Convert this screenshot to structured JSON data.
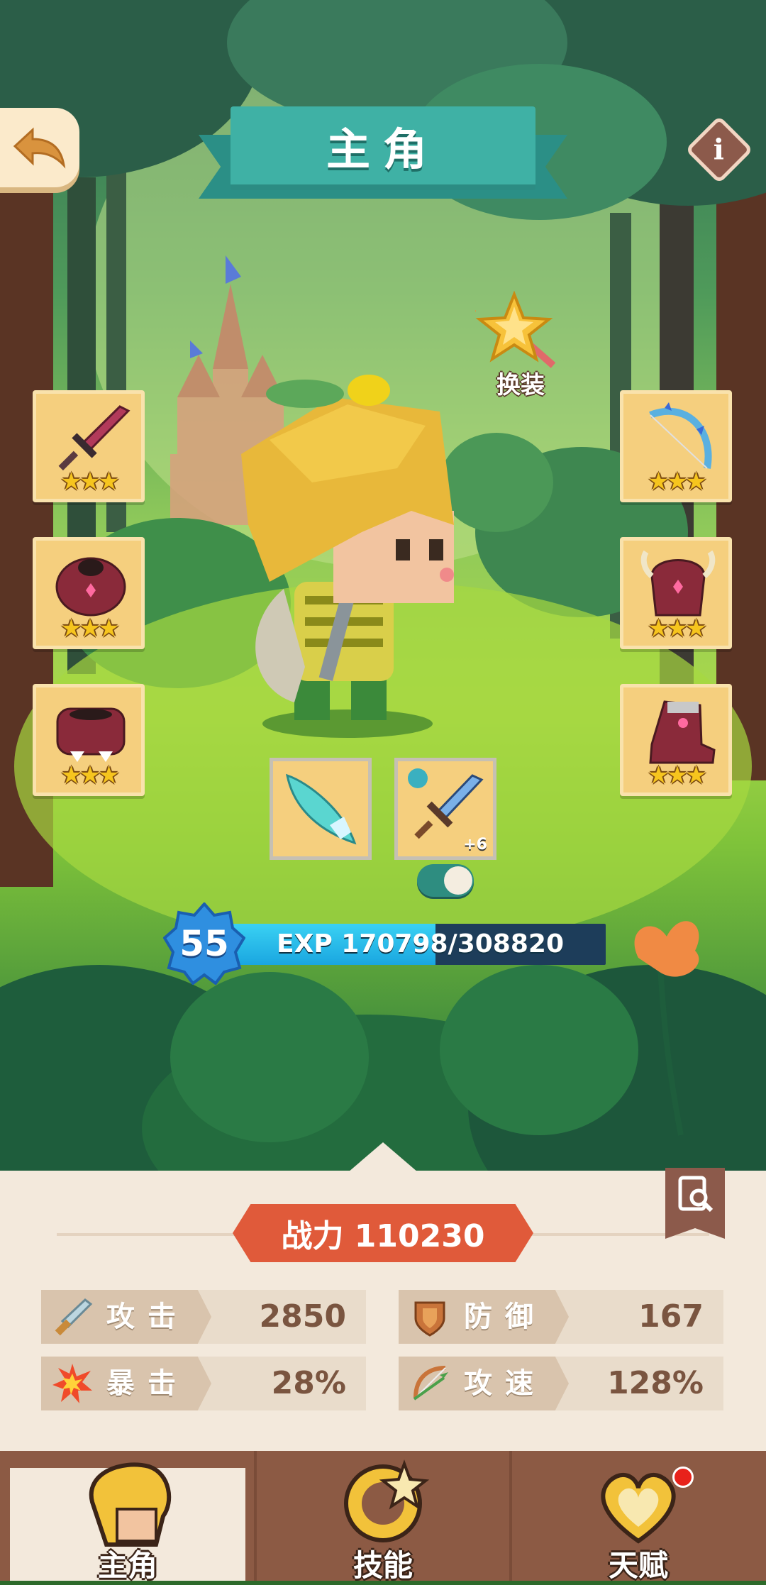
{
  "header": {
    "title": "主角"
  },
  "swap_costume": {
    "label": "换装"
  },
  "equipment": {
    "left": [
      {
        "name": "weapon",
        "stars": "★★★"
      },
      {
        "name": "armor",
        "stars": "★★★"
      },
      {
        "name": "pants",
        "stars": "★★★"
      }
    ],
    "right": [
      {
        "name": "bow",
        "stars": "★★★"
      },
      {
        "name": "helmet",
        "stars": "★★★"
      },
      {
        "name": "boots",
        "stars": "★★★"
      }
    ]
  },
  "weapons": {
    "enhance_level": "+6"
  },
  "toggle": {
    "on": true
  },
  "level": {
    "value": "55",
    "exp_text": "EXP 170798/308820",
    "exp_current": 170798,
    "exp_max": 308820
  },
  "power": {
    "text": "战力 110230"
  },
  "stats": {
    "attack": {
      "label": "攻击",
      "value": "2850"
    },
    "defense": {
      "label": "防御",
      "value": "167"
    },
    "crit": {
      "label": "暴击",
      "value": "28%"
    },
    "attack_speed": {
      "label": "攻速",
      "value": "128%"
    }
  },
  "tabs": [
    {
      "label": "主角",
      "active": true
    },
    {
      "label": "技能",
      "active": false
    },
    {
      "label": "天赋",
      "active": false,
      "badge": true
    }
  ],
  "colors": {
    "title_ribbon": "#3fb1a5",
    "power_banner": "#e05a3a",
    "slot": "#f5cf7e",
    "tabbar": "#8c5a44",
    "panel": "#f3e9dc"
  }
}
